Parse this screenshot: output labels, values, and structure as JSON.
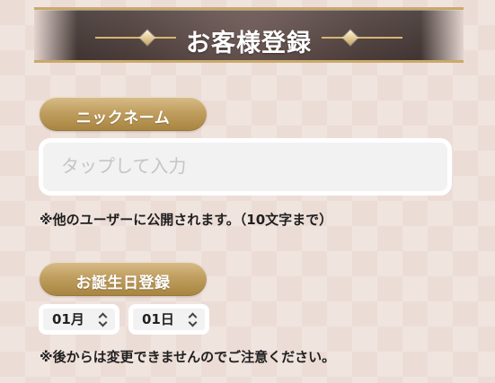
{
  "header": {
    "title": "お客様登録"
  },
  "nickname": {
    "section_label": "ニックネーム",
    "placeholder": "タップして入力",
    "value": "",
    "note": "※他のユーザーに公開されます。（10文字まで）"
  },
  "birthday": {
    "section_label": "お誕生日登録",
    "month_value": "01月",
    "day_value": "01日",
    "note": "※後からは変更できませんのでご注意ください。"
  },
  "icons": {
    "header_ornament_left": "ornament-icon",
    "header_ornament_right": "ornament-icon",
    "select_chevron": "updown-chevron-icon"
  },
  "colors": {
    "background": "#ecdcd6",
    "header_bg": "#4f403d",
    "accent_gold": "#c09e5f",
    "input_bg": "#f2f2f2",
    "text_dark": "#1f1f1f",
    "placeholder": "#c5c5c5"
  }
}
